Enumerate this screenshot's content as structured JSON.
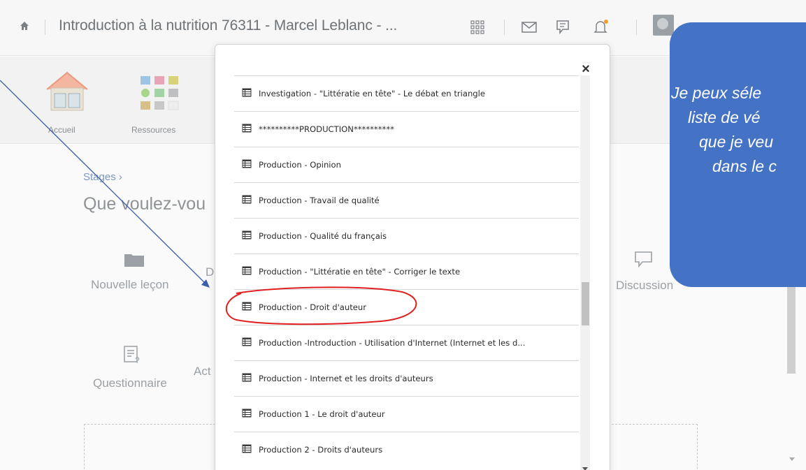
{
  "header": {
    "course_title": "Introduction à la nutrition 76311 - Marcel Leblanc - ..."
  },
  "nav_tiles": [
    {
      "label": "Accueil",
      "icon": "house-icon"
    },
    {
      "label": "Ressources",
      "icon": "resources-grid-icon"
    }
  ],
  "main": {
    "breadcrumb": "Stages ›",
    "heading": "Que voulez-vou",
    "options": [
      {
        "label": "Nouvelle leçon",
        "icon": "folder-icon"
      },
      {
        "label": "D",
        "icon": ""
      },
      {
        "label": "Discussion",
        "icon": "chat-icon"
      },
      {
        "label": "Questionnaire",
        "icon": "quiz-icon"
      },
      {
        "label": "Act",
        "icon": ""
      }
    ]
  },
  "dialog": {
    "close_label": "×",
    "items": [
      "Investigation - \"Littératie en tête\" - Le débat en triangle",
      "**********PRODUCTION**********",
      "Production - Opinion",
      "Production - Travail de qualité",
      "Production - Qualité du français",
      "Production -  \"Littératie en tête\" - Corriger le texte",
      "Production  - Droit d'auteur",
      "Production -Introduction - Utilisation d'Internet (Internet et les d...",
      "Production - Internet et les droits d'auteurs",
      "Production 1 - Le droit d'auteur",
      "Production 2 - Droits d'auteurs"
    ],
    "highlighted_index": 6
  },
  "callout": {
    "lines": [
      "Je peux séle",
      "liste de vé",
      "que je veu",
      "dans le c"
    ]
  },
  "colors": {
    "callout_bg": "#4472c4",
    "highlight_circle": "#e02020",
    "arrow": "#3a5fa8"
  }
}
